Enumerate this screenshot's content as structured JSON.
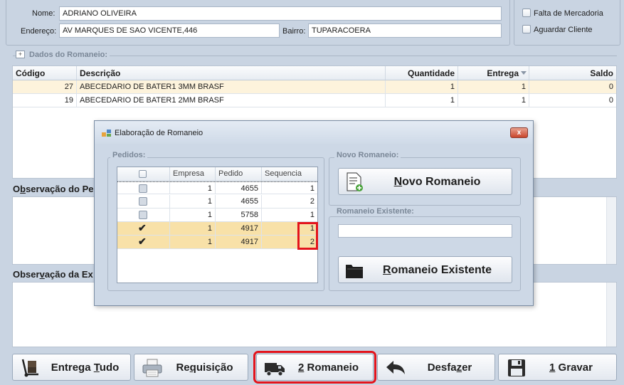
{
  "cliente": {
    "nome_label": "Nome:",
    "nome_value": "ADRIANO OLIVEIRA",
    "endereco_label": "Endereço:",
    "endereco_value": "AV MARQUES DE SAO VICENTE,446",
    "bairro_label": "Bairro:",
    "bairro_value": "TUPARACOERA"
  },
  "flags": {
    "falta_mercadoria": "Falta de Mercadoria",
    "aguardar_cliente": "Aguardar Cliente"
  },
  "dados_romaneio": {
    "title": "Dados do Romaneio:",
    "expand_glyph": "+",
    "columns": [
      "Código",
      "Descrição",
      "Quantidade",
      "Entrega",
      "Saldo"
    ],
    "rows": [
      {
        "codigo": "27",
        "descricao": "ABECEDARIO DE BATER1 3MM BRASF",
        "quantidade": "1",
        "entrega": "1",
        "saldo": "0"
      },
      {
        "codigo": "19",
        "descricao": "ABECEDARIO DE BATER1 2MM BRASF",
        "quantidade": "1",
        "entrega": "1",
        "saldo": "0"
      }
    ]
  },
  "observacao_pedido": {
    "title_pre": "O",
    "title_ul": "b",
    "title_post": "servação do Pe"
  },
  "observacao_expedicao": {
    "title_pre": "Obser",
    "title_ul": "v",
    "title_post": "ação da Ex"
  },
  "toolbar": {
    "entrega_tudo": {
      "pre": "Entrega ",
      "ul": "T",
      "post": "udo"
    },
    "requisicao": {
      "pre": "Re",
      "ul": "q",
      "post": "uisição"
    },
    "romaneio": {
      "pre": "",
      "ul": "2",
      "post": " Romaneio"
    },
    "desfazer": {
      "pre": "Desfa",
      "ul": "z",
      "post": "er"
    },
    "gravar": {
      "pre": "",
      "ul": "1",
      "post": " Gravar"
    }
  },
  "dialog": {
    "title": "Elaboração de Romaneio",
    "close_glyph": "x",
    "pedidos_title": "Pedidos:",
    "pedidos_columns": [
      "Empresa",
      "Pedido",
      "Sequencia"
    ],
    "pedidos_rows": [
      {
        "checked": false,
        "empresa": "1",
        "pedido": "4655",
        "sequencia": "1"
      },
      {
        "checked": false,
        "empresa": "1",
        "pedido": "4655",
        "sequencia": "2"
      },
      {
        "checked": false,
        "empresa": "1",
        "pedido": "5758",
        "sequencia": "1"
      },
      {
        "checked": true,
        "empresa": "1",
        "pedido": "4917",
        "sequencia": "1"
      },
      {
        "checked": true,
        "empresa": "1",
        "pedido": "4917",
        "sequencia": "2"
      }
    ],
    "novo_romaneio_title": "Novo Romaneio:",
    "novo_romaneio_button": {
      "pre": "",
      "ul": "N",
      "post": "ovo Romaneio"
    },
    "romaneio_existente_title": "Romaneio Existente:",
    "romaneio_existente_value": "",
    "romaneio_existente_button": {
      "pre": "",
      "ul": "R",
      "post": "omaneio Existente"
    }
  },
  "colors": {
    "background": "#c9d4e2",
    "selected_row": "#fdf3dc",
    "checked_row": "#f8e1a8",
    "highlight": "#e3141c"
  }
}
